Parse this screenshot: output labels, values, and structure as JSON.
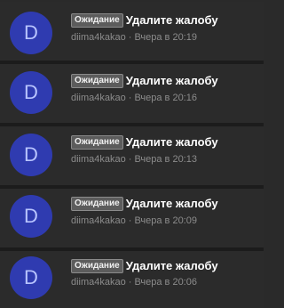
{
  "colors": {
    "background": "#2b2b2b",
    "avatar_bg": "#2f3bb0",
    "avatar_text": "#b8c4ff",
    "badge_bg": "#5c5c5c",
    "title": "#ffffff",
    "meta": "#8c8c8c"
  },
  "items": [
    {
      "avatar_letter": "D",
      "status": "Ожидание",
      "title": "Удалите жалобу",
      "author": "diima4kakao",
      "separator": "·",
      "time": "Вчера в 20:19"
    },
    {
      "avatar_letter": "D",
      "status": "Ожидание",
      "title": "Удалите жалобу",
      "author": "diima4kakao",
      "separator": "·",
      "time": "Вчера в 20:16"
    },
    {
      "avatar_letter": "D",
      "status": "Ожидание",
      "title": "Удалите жалобу",
      "author": "diima4kakao",
      "separator": "·",
      "time": "Вчера в 20:13"
    },
    {
      "avatar_letter": "D",
      "status": "Ожидание",
      "title": "Удалите жалобу",
      "author": "diima4kakao",
      "separator": "·",
      "time": "Вчера в 20:09"
    },
    {
      "avatar_letter": "D",
      "status": "Ожидание",
      "title": "Удалите жалобу",
      "author": "diima4kakao",
      "separator": "·",
      "time": "Вчера в 20:06"
    }
  ]
}
